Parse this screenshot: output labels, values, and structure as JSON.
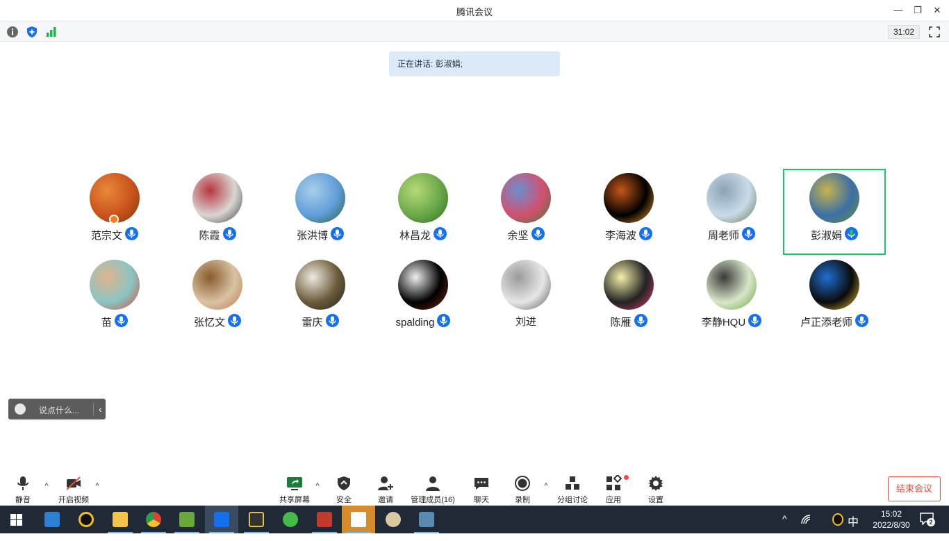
{
  "window": {
    "title": "腾讯会议"
  },
  "top_toolbar": {
    "timer": "31:02"
  },
  "speaking": {
    "text": "正在讲话: 彭淑娟;"
  },
  "participants": [
    {
      "name": "范宗文",
      "mic": "blue",
      "host": true,
      "avatar_colors": [
        "#c9531c",
        "#e9883a",
        "#7a3a10"
      ]
    },
    {
      "name": "陈霞",
      "mic": "blue",
      "avatar_colors": [
        "#d9d6d2",
        "#b73640",
        "#3d3d3d"
      ]
    },
    {
      "name": "张洪博",
      "mic": "blue",
      "avatar_colors": [
        "#5f9ed8",
        "#a9cdea",
        "#2d5b3a"
      ]
    },
    {
      "name": "林昌龙",
      "mic": "blue",
      "avatar_colors": [
        "#6aa74a",
        "#b6da78",
        "#2f6a1d"
      ]
    },
    {
      "name": "余坚",
      "mic": "blue",
      "avatar_colors": [
        "#d2506e",
        "#6b8fcf",
        "#3d7c3d"
      ]
    },
    {
      "name": "李海波",
      "mic": "blue",
      "avatar_colors": [
        "#000000",
        "#c4571a",
        "#f39a2d"
      ]
    },
    {
      "name": "周老师",
      "mic": "blue",
      "avatar_colors": [
        "#c9dbe9",
        "#8aa3b5",
        "#5d7a4a"
      ]
    },
    {
      "name": "彭淑娟",
      "mic": "green",
      "active": true,
      "avatar_colors": [
        "#3b6fa6",
        "#c6b34a",
        "#6b8f3a"
      ]
    },
    {
      "name": "苗",
      "mic": "blue",
      "avatar_colors": [
        "#8ac4c4",
        "#e0b48c",
        "#d9472d"
      ]
    },
    {
      "name": "张忆文",
      "mic": "blue",
      "avatar_colors": [
        "#d9c3a4",
        "#8a5a2c",
        "#b9794a"
      ]
    },
    {
      "name": "雷庆",
      "mic": "blue",
      "avatar_colors": [
        "#6a5a3a",
        "#eeeae0",
        "#222222"
      ]
    },
    {
      "name": "spalding",
      "mic": "blue",
      "avatar_colors": [
        "#000000",
        "#f0f0f0",
        "#7a2d1a"
      ]
    },
    {
      "name": "刘进",
      "mic": "none",
      "avatar_colors": [
        "#e6e6e6",
        "#9a9a9a",
        "#555555"
      ]
    },
    {
      "name": "陈雁",
      "mic": "blue",
      "avatar_colors": [
        "#222222",
        "#f4f0a8",
        "#e04070"
      ]
    },
    {
      "name": "李静HQU",
      "mic": "blue",
      "avatar_colors": [
        "#d7e6c8",
        "#3a3a3a",
        "#6aa03a"
      ]
    },
    {
      "name": "卢正添老师",
      "mic": "blue",
      "avatar_colors": [
        "#0b0b0b",
        "#1f6fd0",
        "#e8c43a"
      ]
    }
  ],
  "chat": {
    "placeholder": "说点什么..."
  },
  "controls": {
    "mute": "静音",
    "video": "开启视频",
    "share": "共享屏幕",
    "security": "安全",
    "invite": "邀请",
    "members": "管理成员(16)",
    "chat": "聊天",
    "record": "录制",
    "breakout": "分组讨论",
    "apps": "应用",
    "settings": "设置",
    "end": "结束会议"
  },
  "taskbar": {
    "time": "15:02",
    "date": "2022/8/30",
    "ime": "中",
    "notifications": "2"
  },
  "colors": {
    "accent": "#1570ef",
    "active_green": "#23c06a",
    "danger": "#e74c3c",
    "taskbar": "#1f2a36"
  }
}
